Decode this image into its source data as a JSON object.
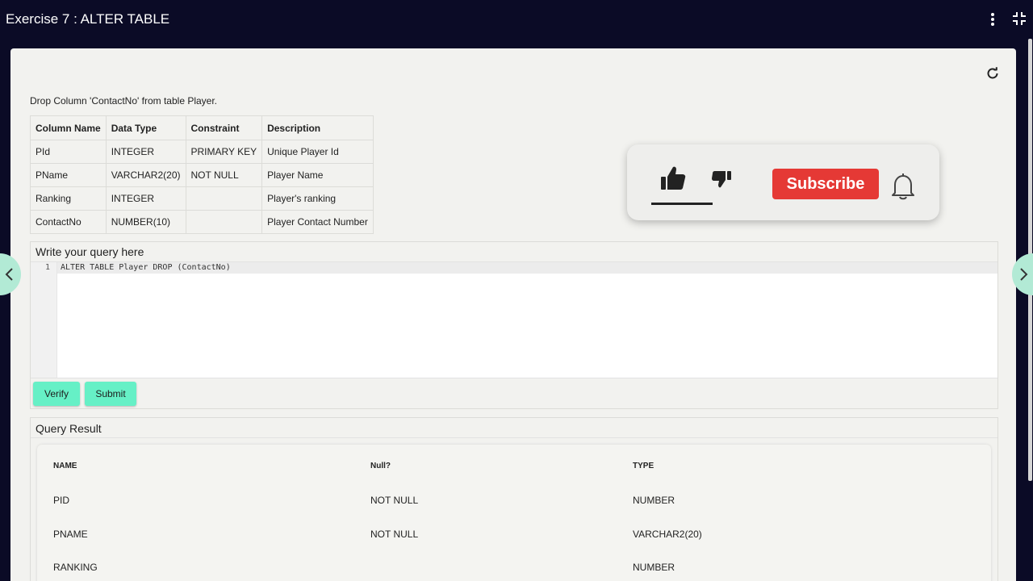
{
  "header": {
    "title": "Exercise 7 : ALTER TABLE"
  },
  "icons": {
    "menu": "more-vertical-icon",
    "exit_fullscreen": "shrink-icon",
    "refresh": "refresh-icon",
    "prev": "chevron-left-icon",
    "next": "chevron-right-icon",
    "like": "thumbs-up-icon",
    "dislike": "thumbs-down-icon",
    "notify": "bell-icon"
  },
  "question": {
    "instruction": "Drop Column 'ContactNo' from table Player.",
    "table": {
      "headers": [
        "Column Name",
        "Data Type",
        "Constraint",
        "Description"
      ],
      "rows": [
        [
          "PId",
          "INTEGER",
          "PRIMARY KEY",
          "Unique Player Id"
        ],
        [
          "PName",
          "VARCHAR2(20)",
          "NOT NULL",
          "Player Name"
        ],
        [
          "Ranking",
          "INTEGER",
          "",
          "Player's ranking"
        ],
        [
          "ContactNo",
          "NUMBER(10)",
          "",
          "Player Contact Number"
        ]
      ]
    }
  },
  "editor": {
    "header": "Write your query here",
    "line_number": "1",
    "code": "ALTER TABLE Player DROP (ContactNo)",
    "verify_label": "Verify",
    "submit_label": "Submit"
  },
  "result": {
    "header": "Query Result",
    "columns": [
      "NAME",
      "Null?",
      "TYPE"
    ],
    "rows": [
      [
        "PID",
        "NOT NULL",
        "NUMBER"
      ],
      [
        "PNAME",
        "NOT NULL",
        "VARCHAR2(20)"
      ],
      [
        "RANKING",
        "",
        "NUMBER"
      ]
    ]
  },
  "overlay": {
    "subscribe_label": "Subscribe"
  },
  "colors": {
    "background": "#0b0b26",
    "panel": "#f2f2ef",
    "button": "#66f0c6",
    "subscribe": "#e53935",
    "nav_arrow": "#b2ead5"
  }
}
